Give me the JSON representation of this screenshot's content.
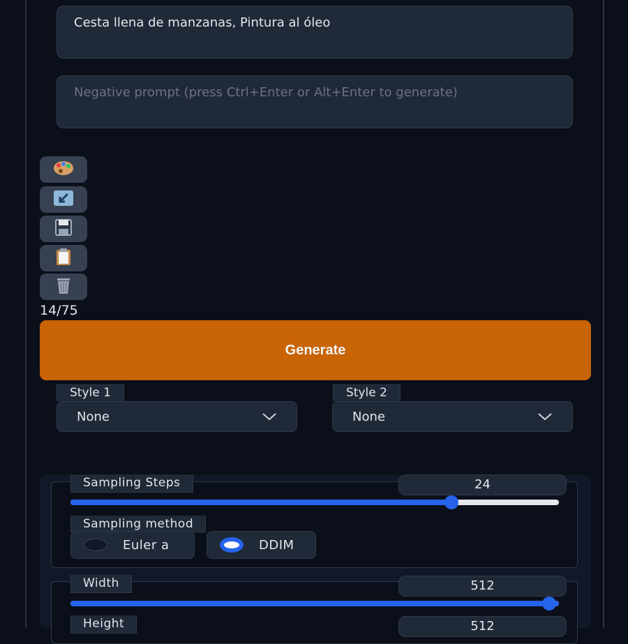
{
  "prompt": {
    "value": "Cesta llena de manzanas, Pintura al óleo",
    "negative_placeholder": "Negative prompt (press Ctrl+Enter or Alt+Enter to generate)"
  },
  "tools": [
    {
      "icon": "palette-icon"
    },
    {
      "icon": "arrow-down-left-icon"
    },
    {
      "icon": "floppy-disk-icon"
    },
    {
      "icon": "clipboard-icon"
    },
    {
      "icon": "trash-icon"
    }
  ],
  "token_counter": "14/75",
  "generate_label": "Generate",
  "styles": [
    {
      "label": "Style 1",
      "value": "None"
    },
    {
      "label": "Style 2",
      "value": "None"
    }
  ],
  "sampling_steps": {
    "label": "Sampling Steps",
    "value": "24",
    "fraction": 0.78
  },
  "sampling_method": {
    "label": "Sampling method",
    "options": [
      {
        "label": "Euler a",
        "selected": false
      },
      {
        "label": "DDIM",
        "selected": true
      }
    ]
  },
  "width": {
    "label": "Width",
    "value": "512",
    "fraction": 1.0
  },
  "height": {
    "label": "Height",
    "value": "512"
  },
  "colors": {
    "accent": "#2563eb",
    "generate": "#c86306",
    "background": "#0b0f19"
  }
}
